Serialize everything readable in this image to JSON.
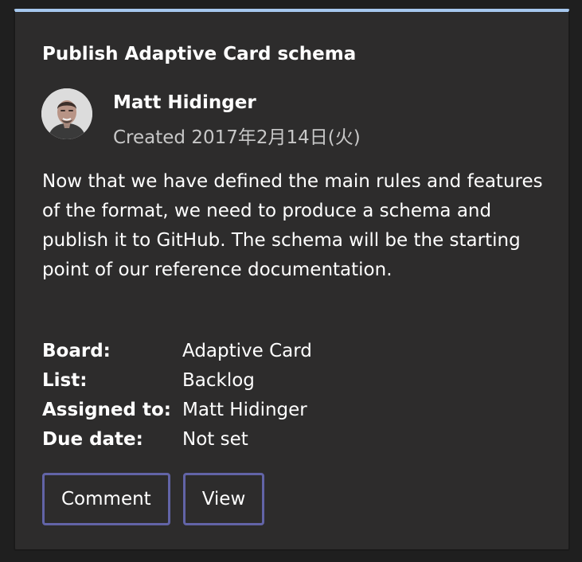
{
  "card": {
    "title": "Publish Adaptive Card schema",
    "accent_color": "#a6c8ee",
    "author": {
      "name": "Matt Hidinger",
      "created": "Created 2017年2月14日(火)",
      "avatar_icon": "person-avatar"
    },
    "description": "Now that we have defined the main rules and features of the format, we need to produce a schema and publish it to GitHub. The schema will be the starting point of our reference documentation.",
    "facts": [
      {
        "title": "Board:",
        "value": "Adaptive Card"
      },
      {
        "title": "List:",
        "value": "Backlog"
      },
      {
        "title": "Assigned to:",
        "value": "Matt Hidinger"
      },
      {
        "title": "Due date:",
        "value": "Not set"
      }
    ],
    "actions": {
      "comment_label": "Comment",
      "view_label": "View",
      "border_color": "#6264a7"
    }
  }
}
